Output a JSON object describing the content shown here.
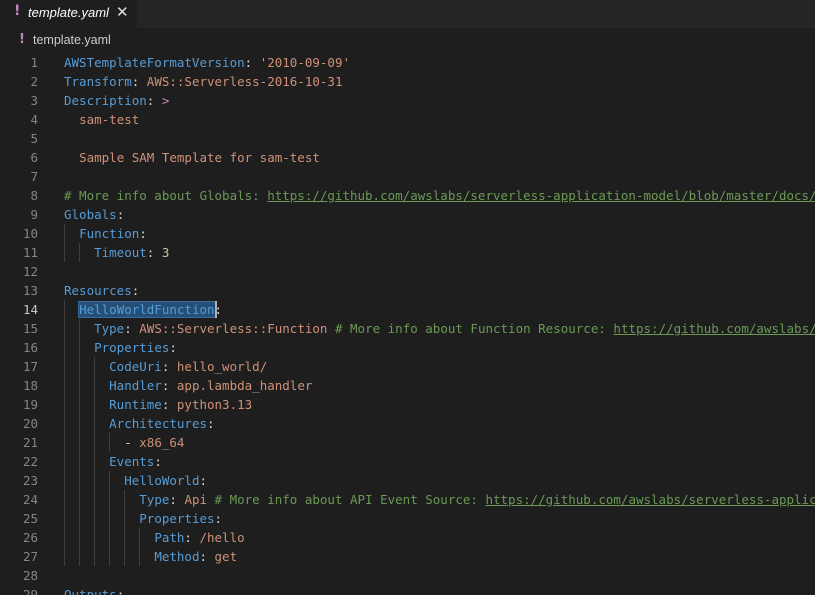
{
  "tab": {
    "warn": "!",
    "filename": "template.yaml",
    "close": "✕"
  },
  "breadcrumb": {
    "warn": "!",
    "filename": "template.yaml"
  },
  "lines": [
    {
      "num": "1",
      "indent": "",
      "parts": [
        [
          "k",
          "AWSTemplateFormatVersion"
        ],
        [
          "p",
          ": "
        ],
        [
          "s",
          "'2010-09-09'"
        ]
      ]
    },
    {
      "num": "2",
      "indent": "",
      "parts": [
        [
          "k",
          "Transform"
        ],
        [
          "p",
          ": "
        ],
        [
          "s",
          "AWS::Serverless-2016-10-31"
        ]
      ]
    },
    {
      "num": "3",
      "indent": "",
      "parts": [
        [
          "k",
          "Description"
        ],
        [
          "p",
          ": "
        ],
        [
          "m",
          ">"
        ]
      ]
    },
    {
      "num": "4",
      "indent": "  ",
      "parts": [
        [
          "s",
          "sam-test"
        ]
      ]
    },
    {
      "num": "5",
      "indent": "",
      "parts": []
    },
    {
      "num": "6",
      "indent": "  ",
      "parts": [
        [
          "s",
          "Sample SAM Template for sam-test"
        ]
      ]
    },
    {
      "num": "7",
      "indent": "",
      "parts": []
    },
    {
      "num": "8",
      "indent": "",
      "parts": [
        [
          "c",
          "# More info about Globals: "
        ],
        [
          "u",
          "https://github.com/awslabs/serverless-application-model/blob/master/docs/globals.rst"
        ]
      ]
    },
    {
      "num": "9",
      "indent": "",
      "parts": [
        [
          "k",
          "Globals"
        ],
        [
          "p",
          ":"
        ]
      ]
    },
    {
      "num": "10",
      "indent": "  ",
      "parts": [
        [
          "k",
          "Function"
        ],
        [
          "p",
          ":"
        ]
      ]
    },
    {
      "num": "11",
      "indent": "    ",
      "parts": [
        [
          "k",
          "Timeout"
        ],
        [
          "p",
          ": "
        ],
        [
          "n",
          "3"
        ]
      ]
    },
    {
      "num": "12",
      "indent": "",
      "parts": []
    },
    {
      "num": "13",
      "indent": "",
      "parts": [
        [
          "k",
          "Resources"
        ],
        [
          "p",
          ":"
        ]
      ]
    },
    {
      "num": "14",
      "indent": "  ",
      "parts": [
        [
          "k sel",
          "HelloWorldFunction"
        ],
        [
          "p",
          ":"
        ]
      ]
    },
    {
      "num": "15",
      "indent": "    ",
      "parts": [
        [
          "k",
          "Type"
        ],
        [
          "p",
          ": "
        ],
        [
          "s",
          "AWS::Serverless::Function"
        ],
        [
          "c",
          " # More info about Function Resource: "
        ],
        [
          "u",
          "https://github.com/awslabs/serverless-application-model"
        ]
      ]
    },
    {
      "num": "16",
      "indent": "    ",
      "parts": [
        [
          "k",
          "Properties"
        ],
        [
          "p",
          ":"
        ]
      ]
    },
    {
      "num": "17",
      "indent": "      ",
      "parts": [
        [
          "k",
          "CodeUri"
        ],
        [
          "p",
          ": "
        ],
        [
          "s",
          "hello_world/"
        ]
      ]
    },
    {
      "num": "18",
      "indent": "      ",
      "parts": [
        [
          "k",
          "Handler"
        ],
        [
          "p",
          ": "
        ],
        [
          "s",
          "app.lambda_handler"
        ]
      ]
    },
    {
      "num": "19",
      "indent": "      ",
      "parts": [
        [
          "k",
          "Runtime"
        ],
        [
          "p",
          ": "
        ],
        [
          "s",
          "python3.13"
        ]
      ]
    },
    {
      "num": "20",
      "indent": "      ",
      "parts": [
        [
          "k",
          "Architectures"
        ],
        [
          "p",
          ":"
        ]
      ]
    },
    {
      "num": "21",
      "indent": "        ",
      "parts": [
        [
          "p",
          "- "
        ],
        [
          "s",
          "x86_64"
        ]
      ]
    },
    {
      "num": "22",
      "indent": "      ",
      "parts": [
        [
          "k",
          "Events"
        ],
        [
          "p",
          ":"
        ]
      ]
    },
    {
      "num": "23",
      "indent": "        ",
      "parts": [
        [
          "k",
          "HelloWorld"
        ],
        [
          "p",
          ":"
        ]
      ]
    },
    {
      "num": "24",
      "indent": "          ",
      "parts": [
        [
          "k",
          "Type"
        ],
        [
          "p",
          ": "
        ],
        [
          "s",
          "Api"
        ],
        [
          "c",
          " # More info about API Event Source: "
        ],
        [
          "u",
          "https://github.com/awslabs/serverless-application-model"
        ]
      ]
    },
    {
      "num": "25",
      "indent": "          ",
      "parts": [
        [
          "k",
          "Properties"
        ],
        [
          "p",
          ":"
        ]
      ]
    },
    {
      "num": "26",
      "indent": "            ",
      "parts": [
        [
          "k",
          "Path"
        ],
        [
          "p",
          ": "
        ],
        [
          "s",
          "/hello"
        ]
      ]
    },
    {
      "num": "27",
      "indent": "            ",
      "parts": [
        [
          "k",
          "Method"
        ],
        [
          "p",
          ": "
        ],
        [
          "s",
          "get"
        ]
      ]
    },
    {
      "num": "28",
      "indent": "",
      "parts": []
    },
    {
      "num": "29",
      "indent": "",
      "parts": [
        [
          "k",
          "Outputs"
        ],
        [
          "p",
          ":"
        ]
      ]
    }
  ],
  "active_line": "14",
  "colors": {
    "keyword": "#569cd6",
    "string": "#ce9178",
    "number": "#b5cea8",
    "comment": "#6a9955",
    "background": "#1e1e1e"
  },
  "icons": {
    "tab_status": "warning-icon",
    "close": "close-icon"
  }
}
